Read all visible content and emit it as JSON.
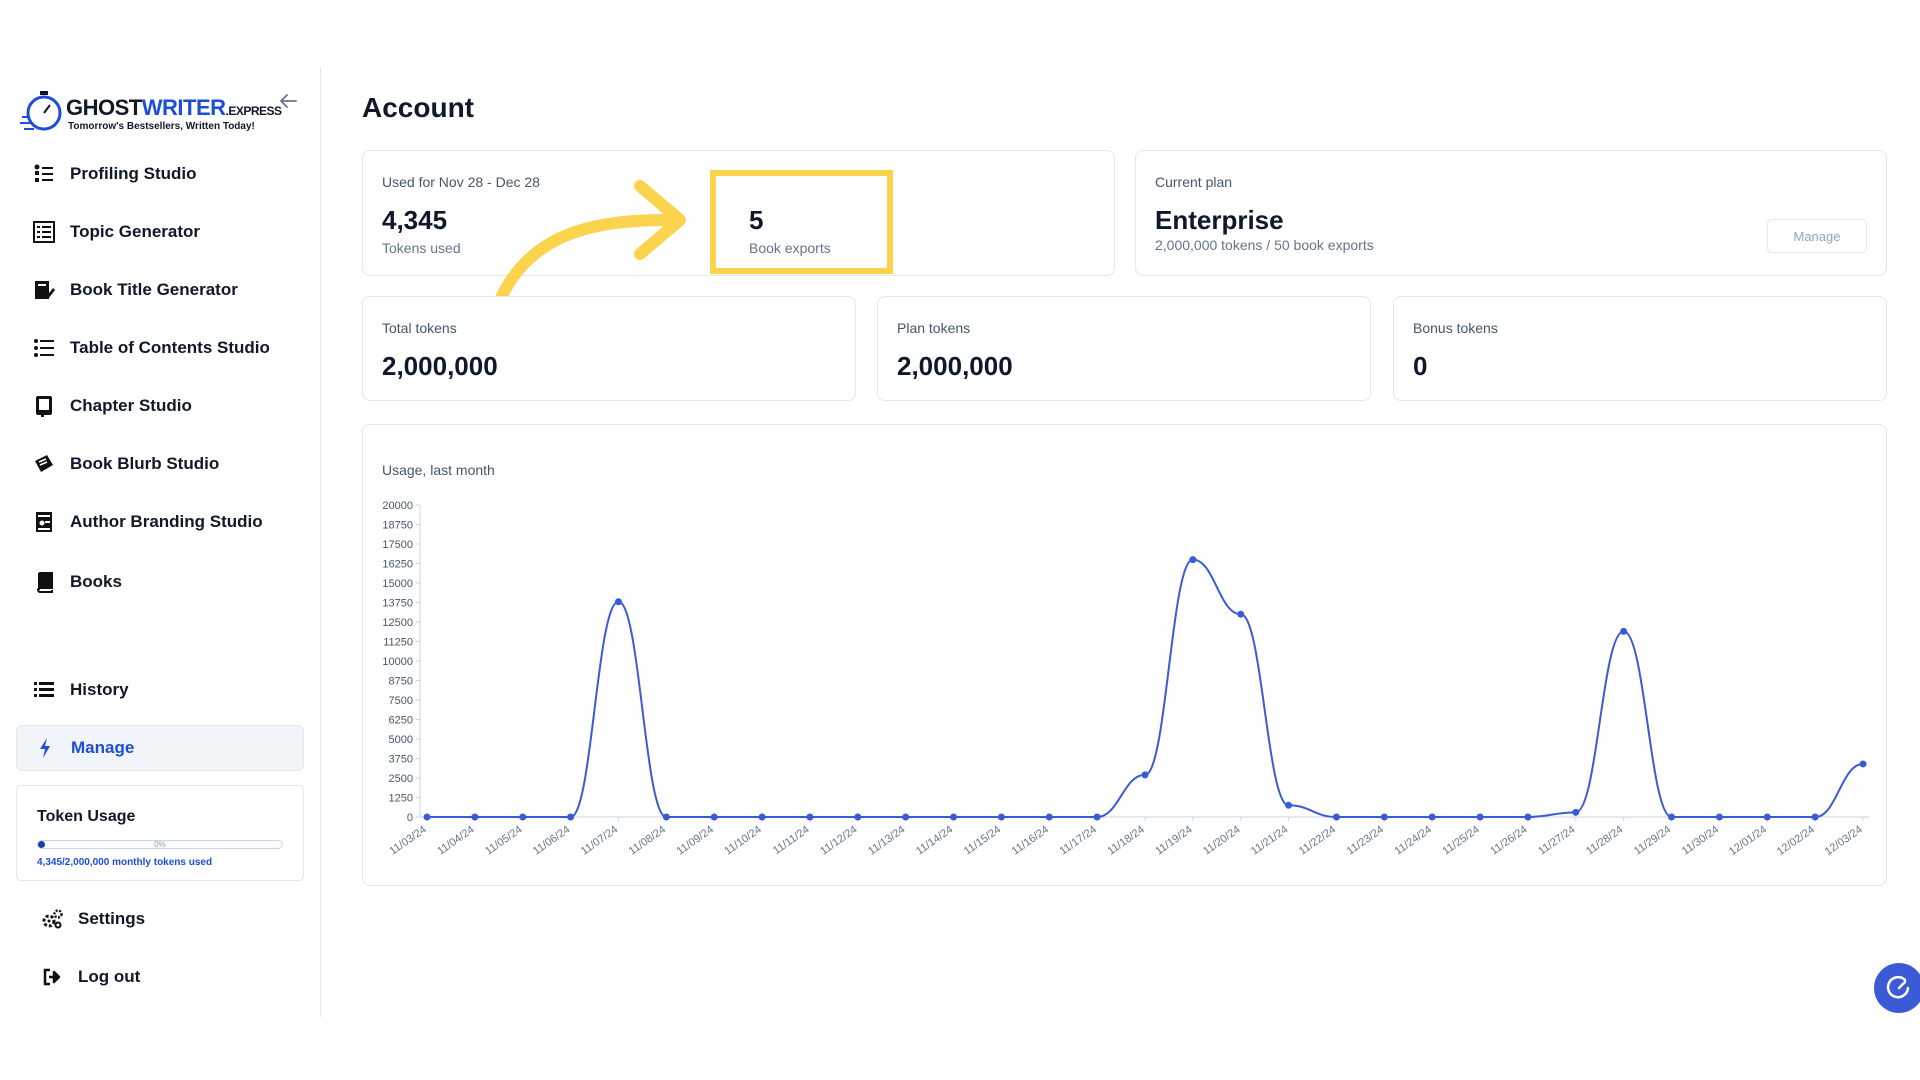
{
  "app": {
    "brand_main": "GHOST",
    "brand_accent": "WRITER",
    "brand_suffix": ".EXPRESS",
    "tagline": "Tomorrow's Bestsellers, Written Today!"
  },
  "sidebar": {
    "items": [
      {
        "label": "Profiling Studio",
        "icon": "profile-list-icon"
      },
      {
        "label": "Topic Generator",
        "icon": "topic-grid-icon"
      },
      {
        "label": "Book Title Generator",
        "icon": "book-edit-icon"
      },
      {
        "label": "Table of Contents Studio",
        "icon": "list-icon"
      },
      {
        "label": "Chapter Studio",
        "icon": "chapter-book-icon"
      },
      {
        "label": "Book Blurb Studio",
        "icon": "book-blurb-icon"
      },
      {
        "label": "Author Branding Studio",
        "icon": "author-badge-icon"
      },
      {
        "label": "Books",
        "icon": "book-icon"
      },
      {
        "label": "History",
        "icon": "history-list-icon"
      },
      {
        "label": "Manage",
        "icon": "bolt-icon",
        "active": true
      },
      {
        "label": "Settings",
        "icon": "gears-icon"
      },
      {
        "label": "Log out",
        "icon": "logout-icon"
      }
    ],
    "token_usage": {
      "title": "Token Usage",
      "percent_label": "0%",
      "fraction_used": 0.0022,
      "summary": "4,345/2,000,000 monthly tokens used"
    }
  },
  "main": {
    "title": "Account",
    "usage_card": {
      "period": "Used for Nov 28 - Dec 28",
      "tokens_used_value": "4,345",
      "tokens_used_caption": "Tokens used",
      "book_exports_value": "5",
      "book_exports_caption": "Book exports"
    },
    "plan_card": {
      "label": "Current plan",
      "plan_name": "Enterprise",
      "details": "2,000,000 tokens / 50 book exports",
      "manage_label": "Manage"
    },
    "stats": [
      {
        "label": "Total tokens",
        "value": "2,000,000"
      },
      {
        "label": "Plan tokens",
        "value": "2,000,000"
      },
      {
        "label": "Bonus tokens",
        "value": "0"
      }
    ],
    "chart_title": "Usage, last month"
  },
  "colors": {
    "accent": "#1d4ed8",
    "line": "#3b5bd6",
    "highlight": "#fcd34d"
  },
  "chart_data": {
    "type": "line",
    "title": "Usage, last month",
    "xlabel": "",
    "ylabel": "",
    "ylim": [
      0,
      20000
    ],
    "yticks": [
      0,
      1250,
      2500,
      3750,
      5000,
      6250,
      7500,
      8750,
      10000,
      11250,
      12500,
      13750,
      15000,
      16250,
      17500,
      18750,
      20000
    ],
    "grid": false,
    "x": [
      "11/03/24",
      "11/04/24",
      "11/05/24",
      "11/06/24",
      "11/07/24",
      "11/08/24",
      "11/09/24",
      "11/10/24",
      "11/11/24",
      "11/12/24",
      "11/13/24",
      "11/14/24",
      "11/15/24",
      "11/16/24",
      "11/17/24",
      "11/18/24",
      "11/19/24",
      "11/20/24",
      "11/21/24",
      "11/22/24",
      "11/23/24",
      "11/24/24",
      "11/25/24",
      "11/26/24",
      "11/27/24",
      "11/28/24",
      "11/29/24",
      "11/30/24",
      "12/01/24",
      "12/02/24",
      "12/03/24"
    ],
    "series": [
      {
        "values": [
          0,
          0,
          0,
          0,
          13800,
          0,
          0,
          0,
          0,
          0,
          0,
          0,
          0,
          0,
          0,
          2700,
          16500,
          13000,
          750,
          0,
          0,
          0,
          0,
          0,
          300,
          11900,
          0,
          0,
          0,
          0,
          3400
        ]
      }
    ]
  }
}
